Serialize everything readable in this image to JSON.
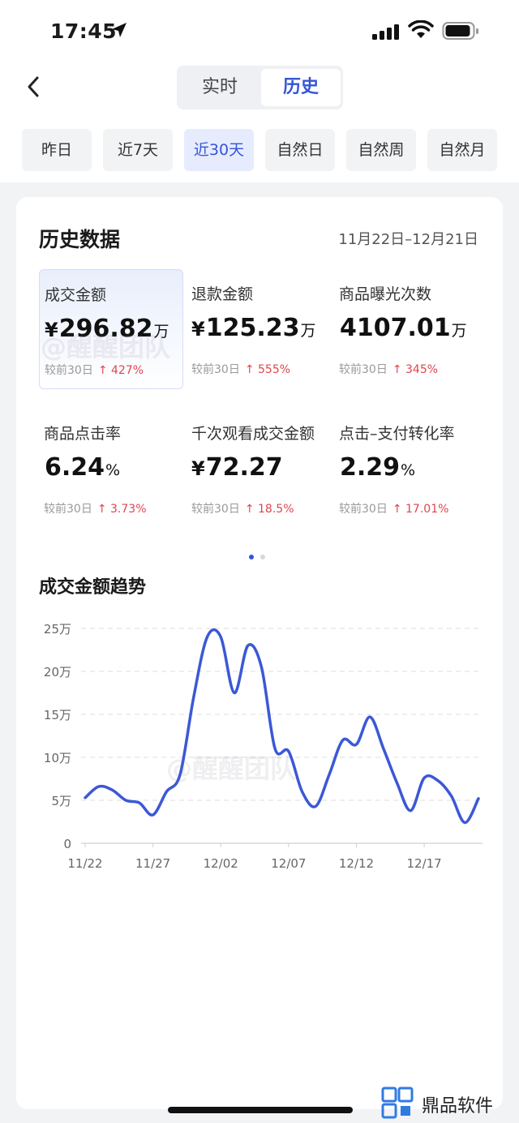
{
  "status_bar": {
    "time": "17:45"
  },
  "nav": {
    "tabs": [
      {
        "label": "实时"
      },
      {
        "label": "历史"
      }
    ]
  },
  "periods": [
    {
      "label": "昨日"
    },
    {
      "label": "近7天"
    },
    {
      "label": "近30天"
    },
    {
      "label": "自然日"
    },
    {
      "label": "自然周"
    },
    {
      "label": "自然月"
    }
  ],
  "card": {
    "title": "历史数据",
    "date_range": "11月22日–12月21日",
    "metrics": [
      {
        "label": "成交金额",
        "prefix": "¥",
        "value": "296.82",
        "unit": "万",
        "compare": "较前30日",
        "change": "427%"
      },
      {
        "label": "退款金额",
        "prefix": "¥",
        "value": "125.23",
        "unit": "万",
        "compare": "较前30日",
        "change": "555%"
      },
      {
        "label": "商品曝光次数",
        "prefix": "",
        "value": "4107.01",
        "unit": "万",
        "compare": "较前30日",
        "change": "345%"
      },
      {
        "label": "商品点击率",
        "prefix": "",
        "value": "6.24",
        "unit": "%",
        "compare": "较前30日",
        "change": "3.73%"
      },
      {
        "label": "千次观看成交金额",
        "prefix": "¥",
        "value": "72.27",
        "unit": "",
        "compare": "较前30日",
        "change": "18.5%"
      },
      {
        "label": "点击–支付转化率",
        "prefix": "",
        "value": "2.29",
        "unit": "%",
        "compare": "较前30日",
        "change": "17.01%"
      }
    ],
    "trend_title": "成交金额趋势"
  },
  "chart_data": {
    "type": "line",
    "title": "成交金额趋势",
    "x_ticks": [
      "11/22",
      "11/27",
      "12/02",
      "12/07",
      "12/12",
      "12/17"
    ],
    "y_ticks": [
      "0",
      "5万",
      "10万",
      "15万",
      "20万",
      "25万"
    ],
    "ylim": [
      0,
      25
    ],
    "grid": true,
    "x": [
      "11/22",
      "11/23",
      "11/24",
      "11/25",
      "11/26",
      "11/27",
      "11/28",
      "11/29",
      "11/30",
      "12/01",
      "12/02",
      "12/03",
      "12/04",
      "12/05",
      "12/06",
      "12/07",
      "12/08",
      "12/09",
      "12/10",
      "12/11",
      "12/12",
      "12/13",
      "12/14",
      "12/15",
      "12/16",
      "12/17",
      "12/18",
      "12/19",
      "12/20",
      "12/21"
    ],
    "values": [
      5.3,
      6.6,
      6.2,
      5.0,
      4.7,
      3.3,
      6.0,
      8.0,
      17.0,
      24.0,
      24.0,
      17.5,
      23.0,
      20.5,
      11.0,
      10.7,
      6.0,
      4.3,
      8.0,
      12.0,
      11.5,
      14.7,
      11.0,
      7.0,
      3.8,
      7.6,
      7.3,
      5.5,
      2.4,
      5.2
    ],
    "color": "#3b58d6"
  },
  "watermarks": [
    "@醒醒团队",
    "@醒醒团队"
  ],
  "brand": {
    "name": "鼎品软件"
  }
}
